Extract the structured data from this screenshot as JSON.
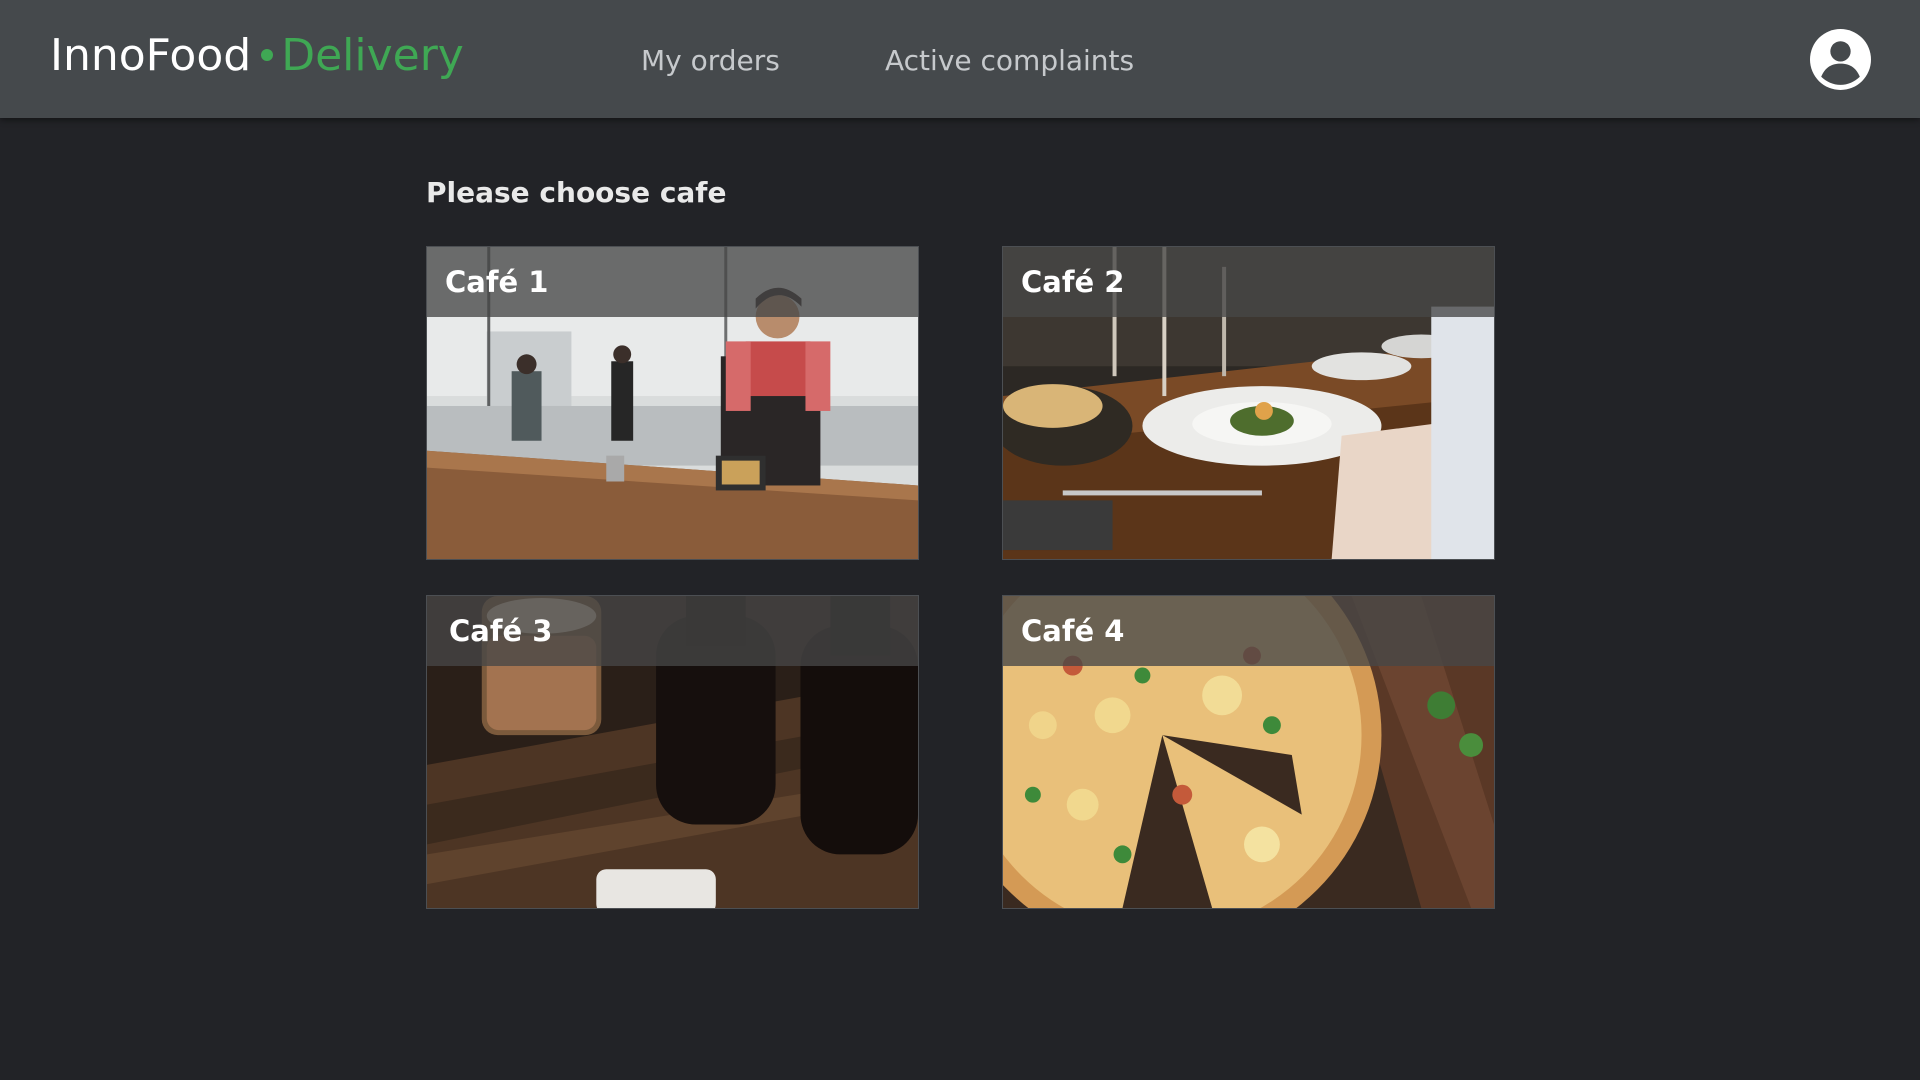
{
  "app": {
    "brand_name": "InnoFood",
    "brand_sub": "Delivery",
    "accent_color": "#3fa854",
    "header_bg": "#45494c",
    "page_bg": "#222327"
  },
  "nav": {
    "links": [
      {
        "label": "My orders"
      },
      {
        "label": "Active complaints"
      }
    ],
    "account_icon": "user-account-icon"
  },
  "main": {
    "heading": "Please choose cafe",
    "cafes": [
      {
        "title": "Café 1",
        "image": "barista-counter-photo"
      },
      {
        "title": "Café 2",
        "image": "restaurant-plated-dish-photo"
      },
      {
        "title": "Café 3",
        "image": "coffee-carafes-photo"
      },
      {
        "title": "Café 4",
        "image": "pizza-photo"
      }
    ]
  }
}
